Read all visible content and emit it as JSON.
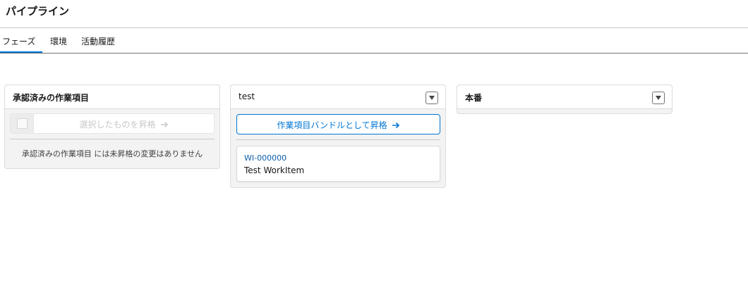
{
  "page": {
    "title": "パイプライン"
  },
  "tabs": [
    {
      "label": "フェーズ",
      "active": true
    },
    {
      "label": "環境",
      "active": false
    },
    {
      "label": "活動履歴",
      "active": false
    }
  ],
  "columns": {
    "approved": {
      "title": "承認済みの作業項目",
      "promote_label": "選択したものを昇格",
      "empty_message": "承認済みの作業項目 には未昇格の変更はありません"
    },
    "test": {
      "title": "test",
      "bundle_button_label": "作業項目バンドルとして昇格",
      "work_item": {
        "id": "WI-000000",
        "name": "Test WorkItem"
      }
    },
    "production": {
      "title": "本番"
    }
  },
  "colors": {
    "accent": "#0176d3",
    "link": "#0b5cab",
    "column_bg": "#f3f3f3",
    "disabled_text": "#c9c9c9"
  },
  "icons": [
    "arrow-right-icon",
    "chevron-down-icon"
  ]
}
